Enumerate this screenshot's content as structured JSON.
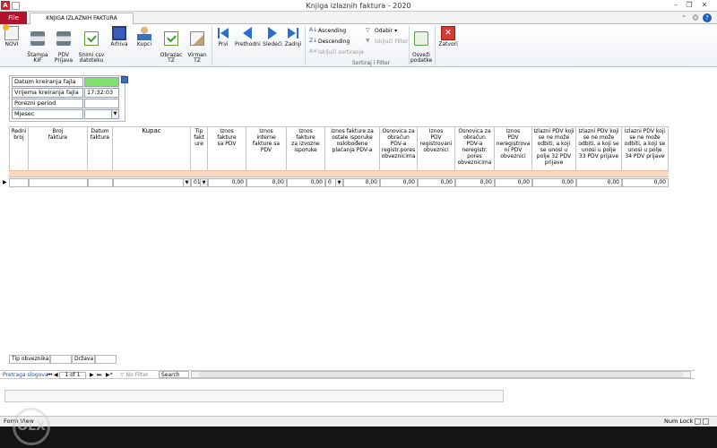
{
  "window": {
    "app_icon_letter": "A",
    "title": "Knjiga izlaznih faktura  -  2020",
    "minimize": "–",
    "restore": "❐",
    "close": "✕"
  },
  "tabs": {
    "file": "File",
    "active": "KNJIGA IZLAZNIH FAKTURA"
  },
  "help_icons": {
    "collapse": "⌃",
    "smiley": "☺",
    "help": "?"
  },
  "ribbon": {
    "buttons": {
      "novi": "NOVI",
      "stampa": "Štampa\nKIF",
      "pdv": "PDV\nPrijava",
      "snimi": "Snimi csv\ndatoteku",
      "arhiva": "Arhiva",
      "kupci": "Kupci",
      "obrazac": "Obrazac\nTZ",
      "virman": "Virman\nTZ",
      "prvi": "Prvi",
      "prethodni": "Prethodni",
      "sledeci": "Sledeći",
      "zadnji": "Zadnji",
      "osvezi": "Osveži\npodatke",
      "zatvori": "Zatvori"
    },
    "sort": {
      "ascending": "Ascending",
      "descending": "Descending",
      "remove_sort": "Isključi sortiranje",
      "selection": "Odabir",
      "toggle_filter": "Isključi Filter",
      "group_label": "Sortiraj i Filter"
    }
  },
  "header_fields": {
    "datum_label": "Datum kreiranja fajla",
    "datum_value": "",
    "vrijeme_label": "Vrijema kreiranja fajla",
    "vrijeme_value": "17:32:03",
    "porezni_label": "Porezni period",
    "porezni_value": "",
    "mjesec_label": "Mjesec",
    "mjesec_value": ""
  },
  "grid": {
    "columns": [
      "Redni\nbroj",
      "Broj\nfakture",
      "Datum\nfakture",
      "Kupac",
      "Tip\nfakt\nure",
      "Iznos\nfakture\nsa PDV",
      "Iznos\ninterne\nfakture sa\nPDV",
      "Iznos\nfakture\nza izvozne\nisporuke",
      "Iznos fakture za\nostale isporuke\noslobođene\nplaćanja PDV-a",
      "Osnovica za\nobračun\nPDV-a\nregistr.pores\nobveznicima",
      "Iznos\nPDV\nregistrovani\nobveznici",
      "Osnovica za\nobračun\nPDV-a\nneregistr.\npores\nobveznicima",
      "Iznos\nPDV\nneregistrova\nni PDV\nobveznici",
      "Izlazni PDV koji\nse ne može\nodbiti, a koji\nse unosi u\npolje 32 PDV\nprijave",
      "Izlazni PDV koji\nse ne može\nodbiti, a koji se\nunosi u polje\n33 PDV prijave",
      "Izlazni PDV koji\nse ne može\nodbiti, a koji se\nunosi u polje\n34 PDV prijave"
    ],
    "row": {
      "selector": "▶",
      "redni_broj": "",
      "broj_fakture": "",
      "datum_fakture": "",
      "kupac": "",
      "tip": "01",
      "iznos_sa_pdv": "0,00",
      "iznos_interne": "0,00",
      "iznos_izvozne": "0,00",
      "ostale_code": "0",
      "ostale_iznos": "0,00",
      "osnovica_reg": "0,00",
      "pdv_reg": "0,00",
      "osnovica_nereg": "0,00",
      "pdv_nereg": "0,00",
      "polje32": "0,00",
      "polje33": "0,00",
      "polje34": "0,00"
    }
  },
  "footer_fields": {
    "tip_obveznika_label": "Tip obveznika",
    "tip_obveznika_value": "",
    "drzava_label": "Država",
    "drzava_value": ""
  },
  "navigator": {
    "label": "Pretraga slogova",
    "first": "⏮",
    "prev": "◀",
    "position": "1 of 1",
    "next": "▶",
    "last": "⏭",
    "new": "▶*",
    "no_filter": "No Filter",
    "search": "Search"
  },
  "status": {
    "left": "Form View",
    "right": "Num Lock"
  },
  "watermark": "OLX"
}
